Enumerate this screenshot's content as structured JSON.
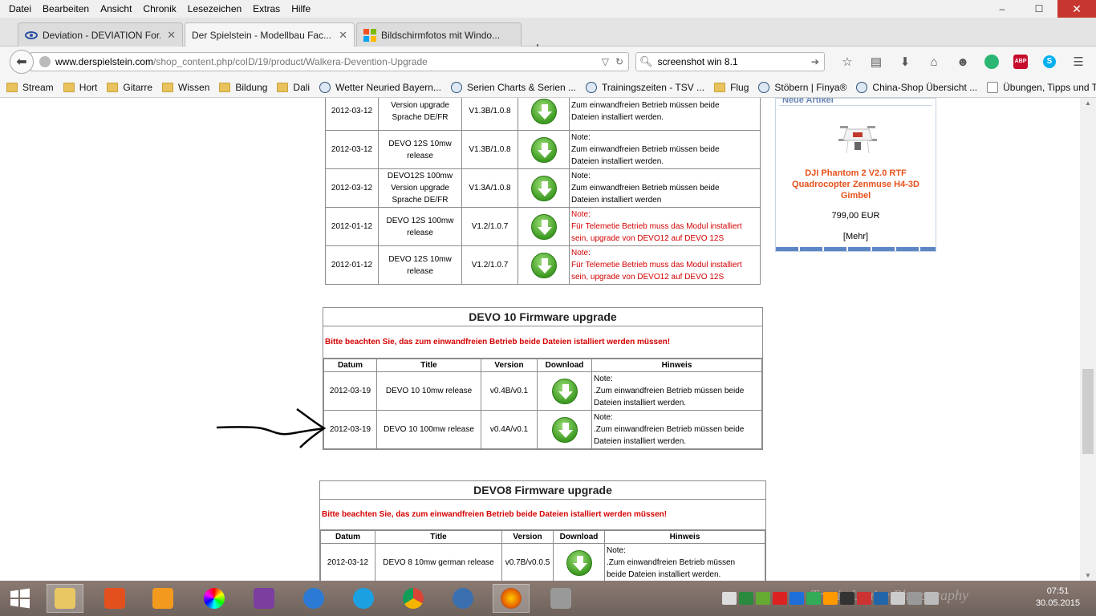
{
  "menu": [
    "Datei",
    "Bearbeiten",
    "Ansicht",
    "Chronik",
    "Lesezeichen",
    "Extras",
    "Hilfe"
  ],
  "window_controls": {
    "minimize": "–",
    "maximize": "☐",
    "close": "✕"
  },
  "tabs": [
    {
      "label": "Deviation - DEVIATION For...",
      "active": false
    },
    {
      "label": "Der Spielstein - Modellbau Fac...",
      "active": true
    },
    {
      "label": "Bildschirmfotos mit Windo...",
      "active": false
    }
  ],
  "new_tab": "+",
  "url": {
    "domain": "www.derspielstein.com",
    "path": "/shop_content.php/coID/19/product/Walkera-Devention-Upgrade"
  },
  "search": {
    "value": "screenshot win 8.1"
  },
  "bookmarks": [
    {
      "label": "Stream",
      "icon": "folder"
    },
    {
      "label": "Hort",
      "icon": "folder"
    },
    {
      "label": "Gitarre",
      "icon": "folder"
    },
    {
      "label": "Wissen",
      "icon": "folder"
    },
    {
      "label": "Bildung",
      "icon": "folder"
    },
    {
      "label": "Dali",
      "icon": "folder"
    },
    {
      "label": "Wetter Neuried Bayern...",
      "icon": "site"
    },
    {
      "label": "Serien Charts & Serien ...",
      "icon": "site"
    },
    {
      "label": "Trainingszeiten - TSV ...",
      "icon": "site"
    },
    {
      "label": "Flug",
      "icon": "folder"
    },
    {
      "label": "Stöbern | Finya®",
      "icon": "site"
    },
    {
      "label": "China-Shop Übersicht ...",
      "icon": "site"
    },
    {
      "label": "Übungen, Tipps und T...",
      "icon": "page"
    }
  ],
  "devo12_rows": [
    {
      "date": "2012-03-12",
      "title": "Version upgrade Sprache DE/FR",
      "version": "V1.3B/1.0.8",
      "hint_lines": [
        "Zum einwandfreien Betrieb müssen beide",
        "Dateien installiert werden."
      ],
      "red": false
    },
    {
      "date": "2012-03-12",
      "title": "DEVO 12S 10mw release",
      "version": "V1.3B/1.0.8",
      "hint_lines": [
        "Note:",
        "Zum einwandfreien Betrieb müssen beide",
        "Dateien installiert werden."
      ],
      "red": false
    },
    {
      "date": "2012-03-12",
      "title": "DEVO12S 100mw Version upgrade Sprache DE/FR",
      "version": "V1.3A/1.0.8",
      "hint_lines": [
        "Note:",
        "Zum einwandfreien Betrieb müssen beide",
        "Dateien installiert werden"
      ],
      "red": false
    },
    {
      "date": "2012-01-12",
      "title": "DEVO 12S 100mw release",
      "version": "V1.2/1.0.7",
      "hint_lines": [
        "Note:",
        "Für Telemetie Betrieb muss das Modul installiert",
        "sein, upgrade von DEVO12 auf DEVO 12S"
      ],
      "red": true
    },
    {
      "date": "2012-01-12",
      "title": "DEVO 12S 10mw release",
      "version": "V1.2/1.0.7",
      "hint_lines": [
        "Note:",
        "Für Telemetie Betrieb muss das Modul installiert",
        "sein, upgrade von DEVO12 auf DEVO 12S"
      ],
      "red": true
    }
  ],
  "devo10": {
    "title": "DEVO 10 Firmware upgrade",
    "warning": "Bitte beachten Sie, das zum einwandfreien Betrieb beide Dateien istalliert werden müssen!",
    "headers": [
      "Datum",
      "Title",
      "Version",
      "Download",
      "Hinweis"
    ],
    "rows": [
      {
        "date": "2012-03-19",
        "title": "DEVO 10 10mw release",
        "version": "v0.4B/v0.1",
        "hint_lines": [
          "Note:",
          ".Zum einwandfreien Betrieb müssen beide",
          "Dateien installiert werden."
        ]
      },
      {
        "date": "2012-03-19",
        "title": "DEVO 10 100mw release",
        "version": "v0.4A/v0.1",
        "hint_lines": [
          "Note:",
          ".Zum einwandfreien Betrieb müssen beide",
          "Dateien installiert werden."
        ]
      }
    ]
  },
  "devo8": {
    "title": "DEVO8 Firmware upgrade",
    "warning": "Bitte beachten Sie, das zum einwandfreien Betrieb beide Dateien istalliert werden müssen!",
    "headers": [
      "Datum",
      "Title",
      "Version",
      "Download",
      "Hinweis"
    ],
    "rows": [
      {
        "date": "2012-03-12",
        "title": "DEVO 8 10mw german release",
        "version": "v0.7B/v0.0.5",
        "hint_lines": [
          "Note:",
          ".Zum einwandfreien Betrieb müssen",
          "beide Dateien installiert werden."
        ]
      }
    ]
  },
  "new_products": {
    "heading": "Neue Artikel",
    "name_lines": [
      "DJI Phantom 2 V2.0 RTF",
      "Quadrocopter Zenmuse H4-3D",
      "Gimbel"
    ],
    "price": "799,00 EUR",
    "more": "[Mehr]"
  },
  "taskbar": {
    "watermark": "Tracie Louise Photography",
    "time": "07:51",
    "date": "30.05.2015"
  },
  "colors": {
    "warning_red": "#d40000",
    "product_orange": "#e8501a",
    "close_red": "#c7372f"
  }
}
